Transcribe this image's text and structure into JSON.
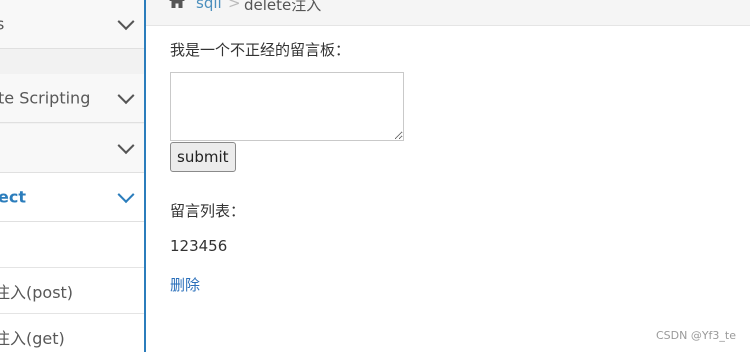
{
  "breadcrumb": {
    "link": "sqli",
    "separator": ">",
    "current": "delete注入"
  },
  "sidebar": {
    "items": [
      {
        "label": "s"
      },
      {
        "label": "te Scripting"
      },
      {
        "label": ""
      },
      {
        "label": "ect"
      }
    ],
    "subitems": [
      {
        "label": ""
      },
      {
        "label": "注入(post)"
      },
      {
        "label": "注入(get)"
      }
    ]
  },
  "main": {
    "prompt": "我是一个不正经的留言板：",
    "textarea_value": "",
    "submit_label": "submit",
    "list_title": "留言列表：",
    "messages": [
      {
        "text": "123456",
        "delete_label": "删除"
      }
    ]
  },
  "watermark": "CSDN @Yf3_te",
  "colors": {
    "accent": "#2b7dbc",
    "link": "#4c8fbd"
  }
}
